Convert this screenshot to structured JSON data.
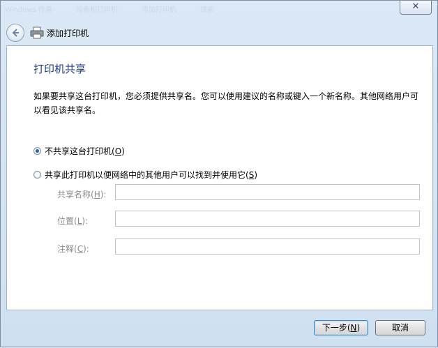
{
  "window": {
    "title_ghost": [
      "Windows 传真",
      "设备和打印机",
      "添加打印机",
      "搜索"
    ],
    "close_label": "✕"
  },
  "nav": {
    "title": "添加打印机"
  },
  "main": {
    "heading": "打印机共享",
    "description": "如果要共享这台打印机，您必须提供共享名。您可以使用建议的名称或键入一个新名称。其他网络用户可以看见该共享名。",
    "option_no_share": {
      "label": "不共享这台打印机",
      "key": "O",
      "checked": true
    },
    "option_share": {
      "label": "共享此打印机以便网络中的其他用户可以找到并使用它",
      "key": "S",
      "checked": false
    },
    "fields": [
      {
        "label": "共享名称",
        "key": "H",
        "value": ""
      },
      {
        "label": "位置",
        "key": "L",
        "value": ""
      },
      {
        "label": "注释",
        "key": "C",
        "value": ""
      }
    ]
  },
  "footer": {
    "next_label": "下一步",
    "next_key": "N",
    "cancel_label": "取消"
  },
  "colors": {
    "heading": "#1e3a8a",
    "disabled_label": "#8a8a8a",
    "window_bg": "#dce9f6"
  }
}
